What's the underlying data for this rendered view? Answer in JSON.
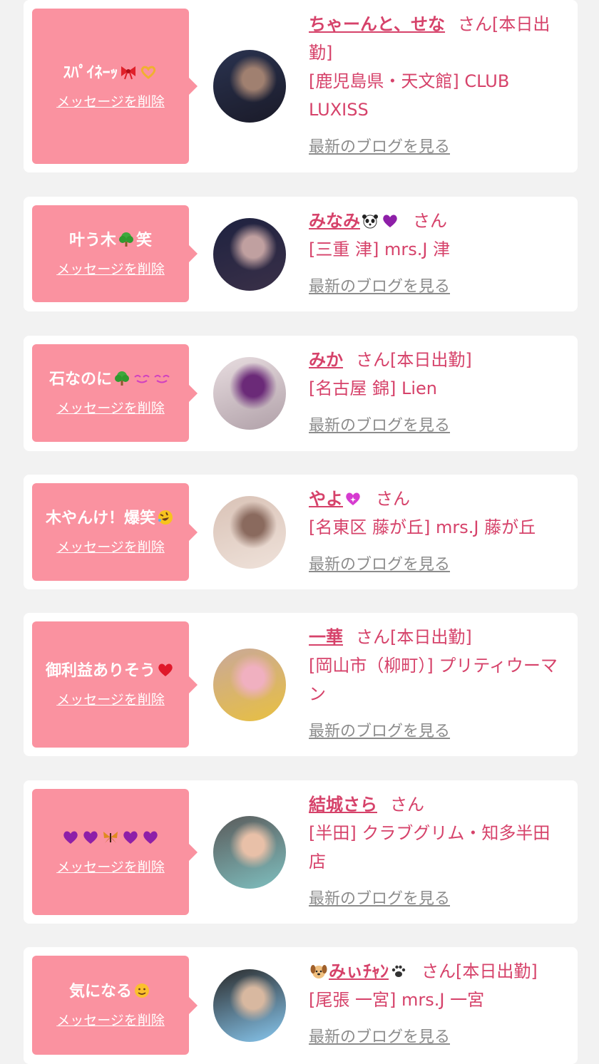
{
  "labels": {
    "delete": "メッセージを削除",
    "blog": "最新のブログを見る",
    "san": "さん",
    "today": "[本日出勤]"
  },
  "cards": [
    {
      "message": "ｽﾊﾟｲﾈｰｯ",
      "message_emojis": [
        "ribbon-emoji",
        "heart-hands-emoji"
      ],
      "name": "ちゃーんと、せな",
      "name_emojis": [],
      "suffix": "さん[本日出勤]",
      "shop": "[鹿児島県・天文館] CLUB LUXISS",
      "avatar_colors": [
        "#2a3350",
        "#a08070",
        "#1a1a28"
      ]
    },
    {
      "message": "叶う木",
      "message_emojis": [
        "tree-emoji"
      ],
      "message_tail": "笑",
      "name": "みなみ",
      "name_emojis": [
        "panda-emoji",
        "purple-heart-emoji"
      ],
      "suffix": "さん",
      "shop": "[三重 津] mrs.J 津",
      "avatar_colors": [
        "#1e2240",
        "#c0a0a0",
        "#3a3048"
      ]
    },
    {
      "message": "石なのに",
      "message_emojis": [
        "tree-emoji",
        "face-emoji",
        "face-emoji"
      ],
      "name": "みか",
      "name_emojis": [],
      "suffix": "さん[本日出勤]",
      "shop": "[名古屋 錦] Lien",
      "avatar_colors": [
        "#e8dde0",
        "#6b2a78",
        "#b0a0a8"
      ]
    },
    {
      "message": "木やんけ！爆笑",
      "message_emojis": [
        "rolling-laugh-emoji"
      ],
      "name": "やよ",
      "name_emojis": [
        "sparkling-heart-emoji"
      ],
      "suffix": "さん",
      "shop": "[名東区 藤が丘] mrs.J 藤が丘",
      "avatar_colors": [
        "#d9c2b6",
        "#8a6a5e",
        "#efe2da"
      ]
    },
    {
      "message": "御利益ありそう",
      "message_emojis": [
        "red-heart-emoji"
      ],
      "name": "一華",
      "name_emojis": [],
      "suffix": "さん[本日出勤]",
      "shop": "[岡山市（柳町）] プリティウーマン",
      "avatar_colors": [
        "#c9a89a",
        "#f0b0c0",
        "#e8c040"
      ]
    },
    {
      "message": "",
      "message_emojis": [
        "purple-heart-emoji",
        "purple-heart-emoji",
        "butterfly-emoji",
        "purple-heart-emoji",
        "purple-heart-emoji"
      ],
      "name": "結城さら",
      "name_emojis": [],
      "suffix": "さん",
      "shop": "[半田] クラブグリム・知多半田店",
      "avatar_colors": [
        "#5a5a5a",
        "#e8c0a8",
        "#7fc0c0"
      ]
    },
    {
      "message": "気になる",
      "message_emojis": [
        "smile-emoji"
      ],
      "name": "みぃﾁｬﾝ",
      "name_lead_emojis": [
        "dog-emoji"
      ],
      "name_emojis": [
        "paw-emoji"
      ],
      "suffix": "さん[本日出勤]",
      "shop": "[尾張 一宮] mrs.J 一宮",
      "avatar_colors": [
        "#2a2a2a",
        "#d8b8a0",
        "#88c8f0"
      ]
    }
  ]
}
